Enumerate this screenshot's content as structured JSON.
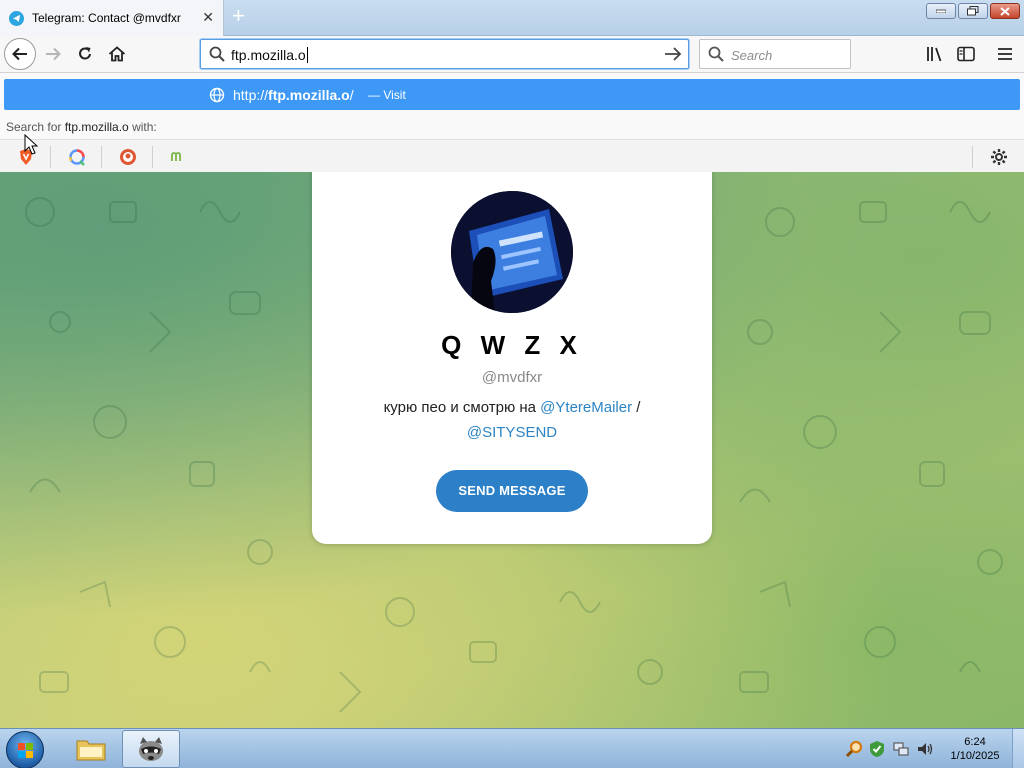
{
  "browser": {
    "tab": {
      "title": "Telegram: Contact @mvdfxr",
      "close_glyph": "✕"
    },
    "new_tab_glyph": "+",
    "url_bar": {
      "value": "ftp.mozilla.o"
    },
    "search_bar": {
      "placeholder": "Search"
    },
    "autocomplete": {
      "url_prefix": "http://",
      "url_bold": "ftp.mozilla.o",
      "url_suffix": "/",
      "action": "— Visit",
      "search_for_prefix": "Search for",
      "search_for_term": "ftp.mozilla.o",
      "search_for_suffix": "with:",
      "engines": [
        "brave-search-icon",
        "qwant-icon",
        "duckduckgo-icon",
        "mojeek-icon"
      ]
    },
    "accent_color": "#3d99f5"
  },
  "profile": {
    "name": "Q W Z X",
    "username": "@mvdfxr",
    "bio_text": "курю пео и смотрю на",
    "bio_mention_1": "@YtereMailer",
    "bio_separator": "/",
    "bio_mention_2": "@SITYSEND",
    "button_label": "SEND MESSAGE",
    "button_color": "#2b80c7",
    "mention_color": "#2d84c4"
  },
  "taskbar": {
    "items": [
      "windows-start-orb",
      "file-explorer-icon",
      "raccoon-app-icon"
    ],
    "time": "6:24",
    "date": "1/10/2025"
  }
}
